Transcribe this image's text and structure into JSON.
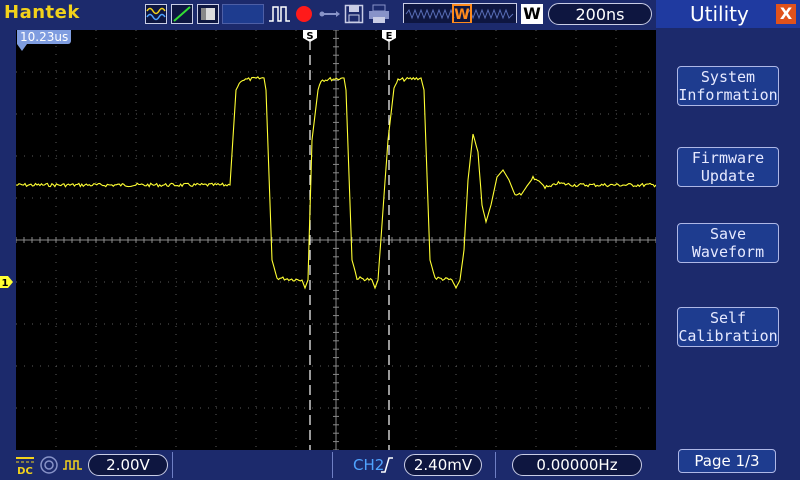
{
  "header": {
    "brand": "Hantek",
    "timebase": "200ns",
    "mode_letter": "W",
    "trigger_letter": "W"
  },
  "screen": {
    "time_offset": "10.23us",
    "cursor_start_label": "S",
    "cursor_end_label": "E",
    "channel_marker": "1"
  },
  "sidebar": {
    "title": "Utility",
    "close_symbol": "X",
    "buttons": [
      {
        "line1": "System",
        "line2": "Information"
      },
      {
        "line1": "Firmware",
        "line2": "Update"
      },
      {
        "line1": "Save",
        "line2": "Waveform"
      },
      {
        "line1": "Self",
        "line2": "Calibration"
      }
    ],
    "page": "Page 1/3"
  },
  "footer": {
    "coupling": "DC",
    "volts_div": "2.00V",
    "trigger_source": "CH2",
    "trigger_level": "2.40mV",
    "frequency": "0.00000Hz"
  },
  "colors": {
    "trace": "#ffff33",
    "background": "#1c2a6c",
    "accent_blue": "#4fa3ff"
  }
}
